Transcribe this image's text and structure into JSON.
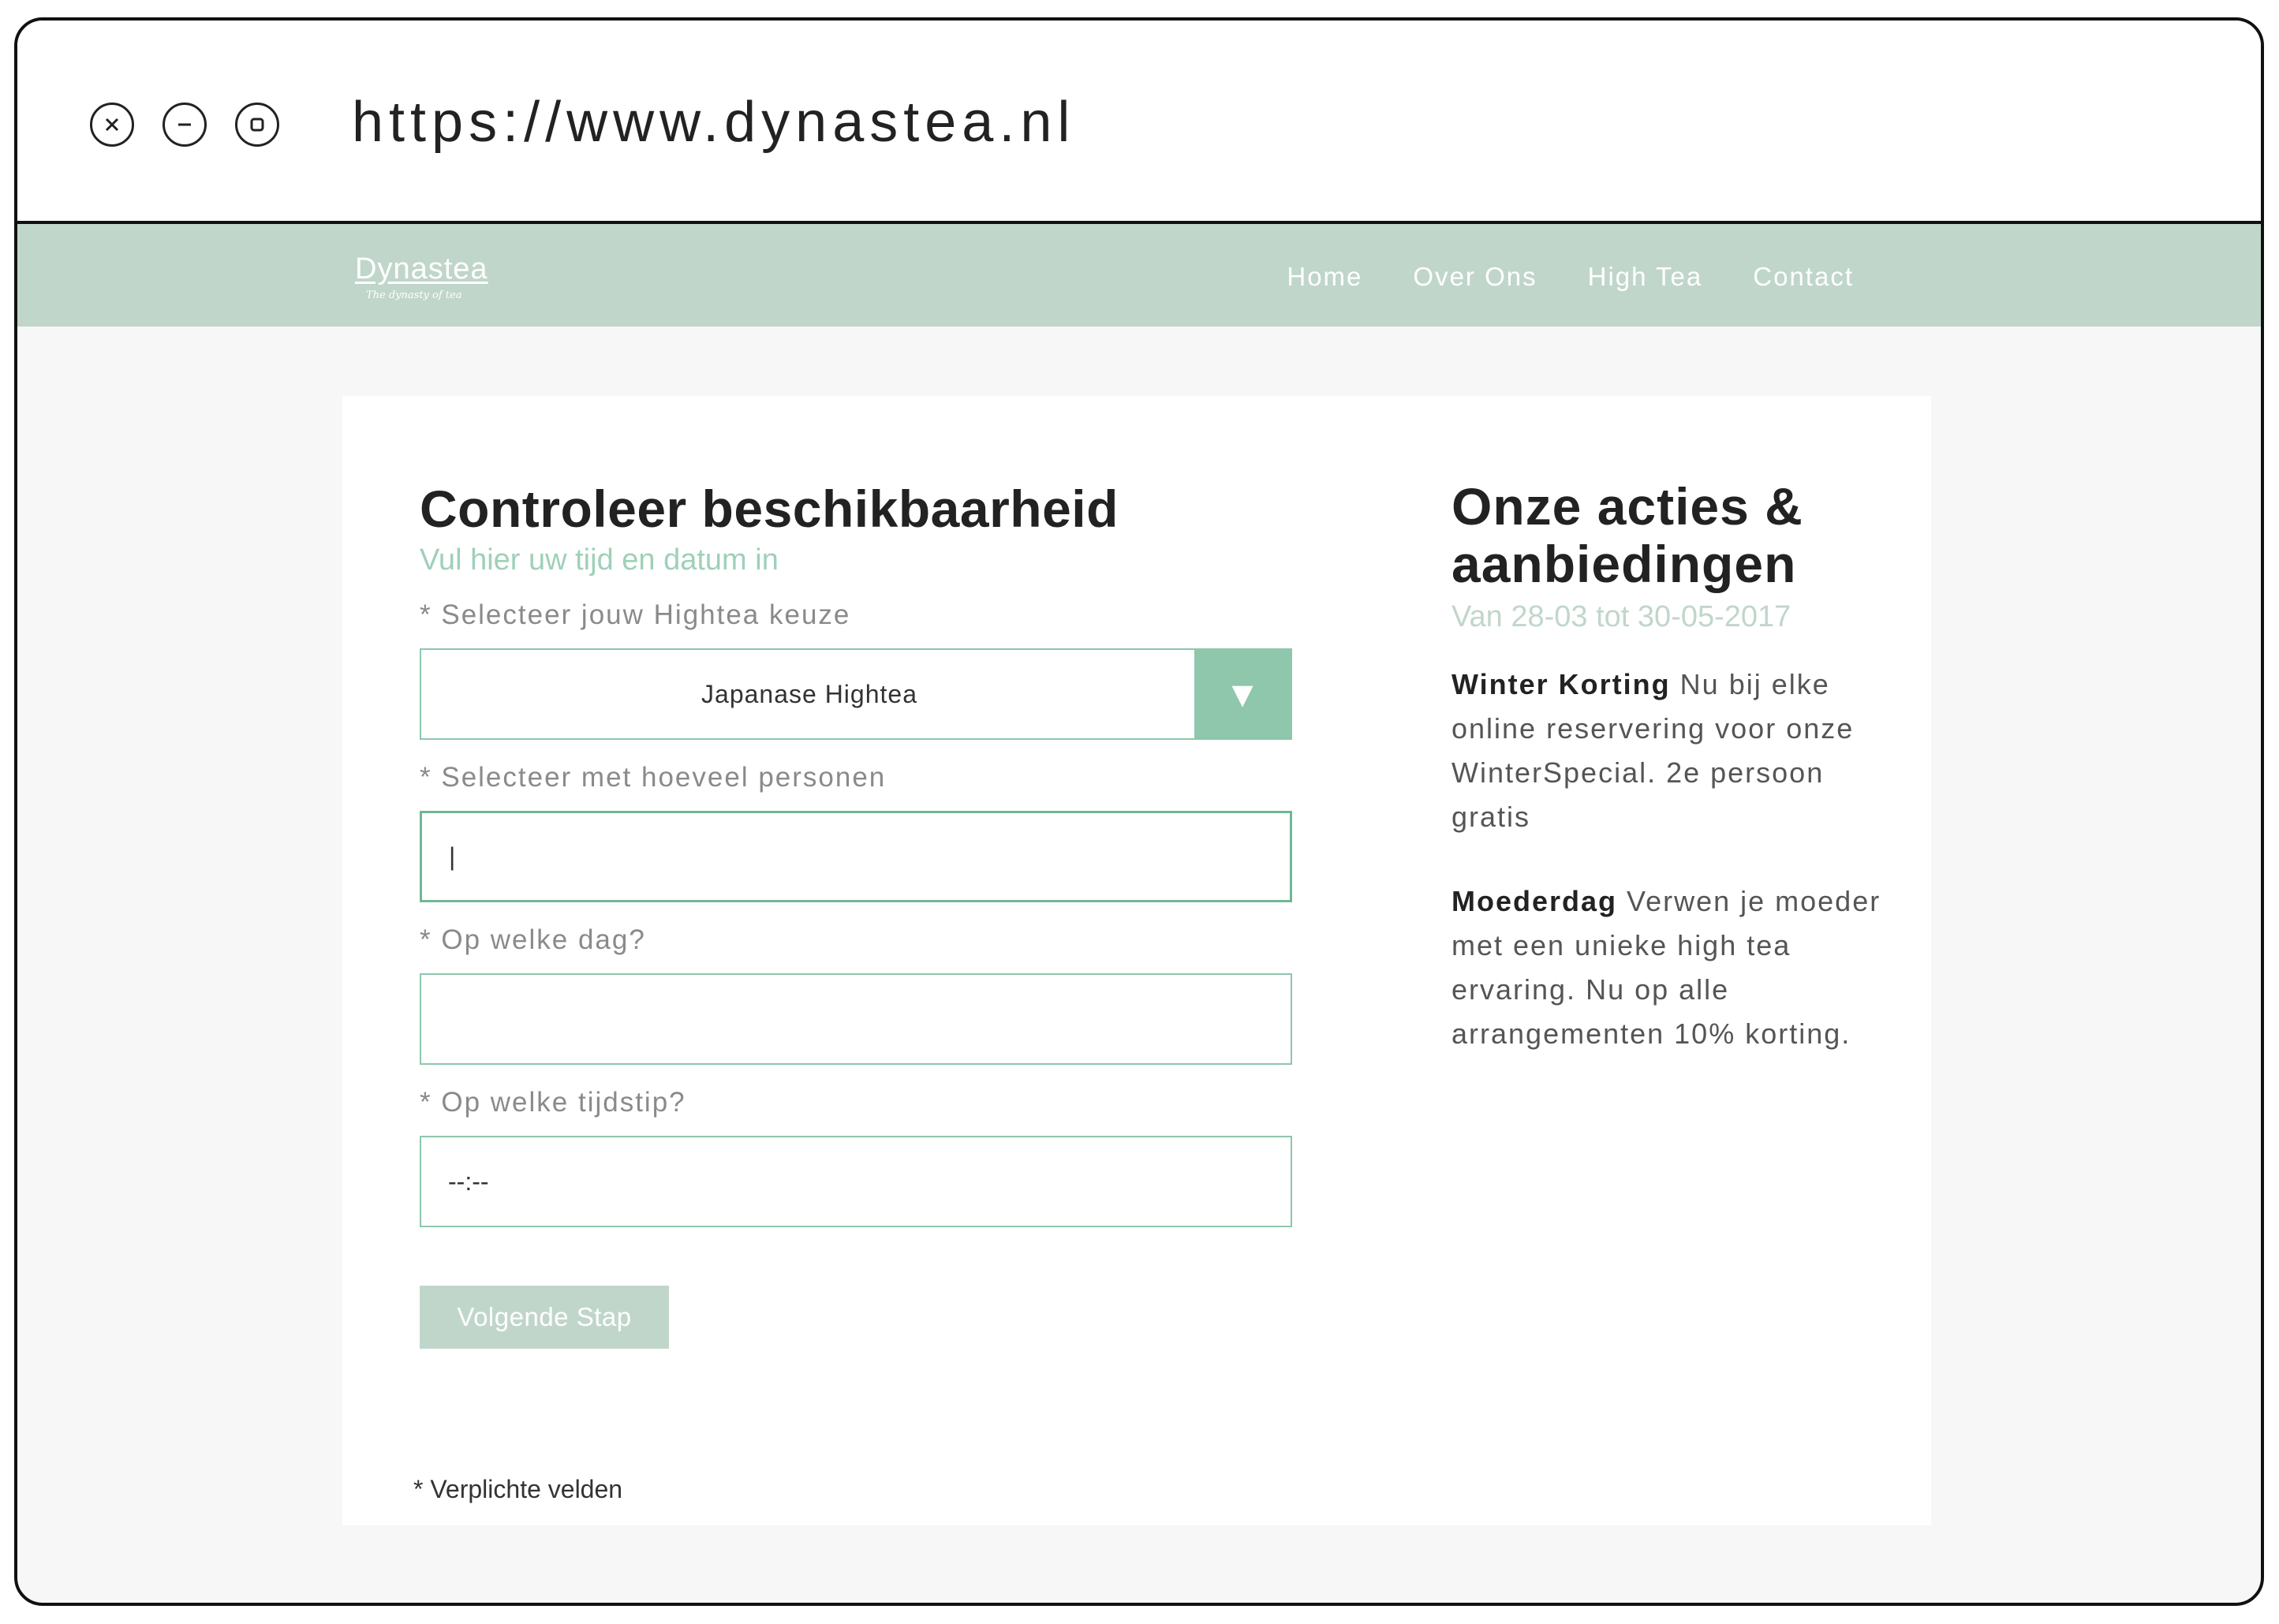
{
  "browser": {
    "url": "https://www.dynastea.nl"
  },
  "site": {
    "logo_name": "Dynastea",
    "logo_tagline": "The dynasty of tea",
    "nav": [
      "Home",
      "Over Ons",
      "High Tea",
      "Contact"
    ]
  },
  "form": {
    "title": "Controleer beschikbaarheid",
    "subtitle": "Vul hier uw tijd en datum in",
    "hightea_label": "* Selecteer jouw Hightea keuze",
    "hightea_value": "Japanase Hightea",
    "persons_label": "* Selecteer met hoeveel personen",
    "persons_value": "|",
    "day_label": "* Op welke dag?",
    "day_value": "",
    "time_label": "* Op welke tijdstip?",
    "time_value": "--:--",
    "next_button": "Volgende Stap",
    "required_note": "* Verplichte velden"
  },
  "offers": {
    "title": "Onze acties & aanbiedingen",
    "period": "Van 28-03 tot 30-05-2017",
    "items": [
      {
        "name": "Winter Korting",
        "text": "Nu bij elke online reservering voor onze WinterSpecial. 2e persoon gratis"
      },
      {
        "name": "Moederdag",
        "text": "Verwen je moeder met een unieke high tea ervaring. Nu op alle arrangementen 10% korting."
      }
    ]
  },
  "colors": {
    "accent": "#8ec7ac",
    "nav_bg": "#c1d6cb",
    "subtitle": "#9fd0b8"
  }
}
